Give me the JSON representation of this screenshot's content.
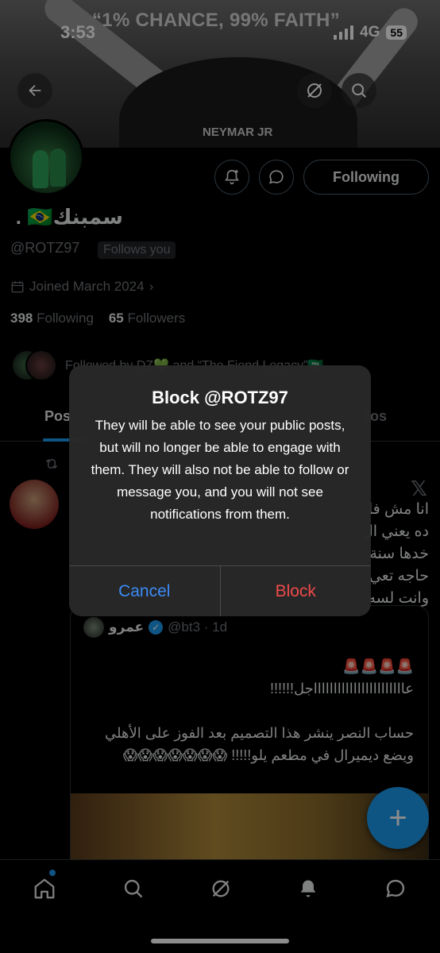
{
  "status_bar": {
    "time": "3:53",
    "network": "4G",
    "battery": "55"
  },
  "banner": {
    "quote": "“1% CHANCE, 99% FAITH”",
    "jersey": "NEYMAR JR"
  },
  "profile": {
    "name": "سمبنك🇧🇷 .",
    "handle": "@ROTZ97",
    "follows_you": "Follows you",
    "joined": "Joined March 2024",
    "following_count": "398",
    "following_label": "Following",
    "followers_count": "65",
    "followers_label": "Followers",
    "followed_by": "Followed by DZ💚 and “The Fiend Legacy”🇸🇦",
    "following_button": "Following"
  },
  "tabs": [
    {
      "label": "Pos"
    },
    {
      "label": "tos"
    }
  ],
  "post": {
    "text": "انا مش فا\nده يعني ال\nخدها سنة\nحاجه تعي\nوانت لسه",
    "quote": {
      "name": "عمرو",
      "meta": "@bt3 · 1d",
      "body": "🚨🚨🚨🚨\nعاااااااااااااااااااااااجل!!!!!!\n\nحساب النصر ينشر هذا التصميم بعد الفوز على الأهلي ويضع ديميرال في مطعم يلو!!!!! 😱😱😱😱😱😱😱"
    }
  },
  "dialog": {
    "title": "Block @ROTZ97",
    "message": "They will be able to see your public posts, but will no longer be able to engage with them. They will also not be able to follow or message you, and you will not see notifications from them.",
    "cancel_label": "Cancel",
    "block_label": "Block"
  },
  "colors": {
    "accent": "#1d9bf0",
    "destructive": "#f04a4a",
    "cancel": "#3b8bf7"
  },
  "icons": [
    "back-arrow-icon",
    "grok-icon",
    "search-icon",
    "notify-plus-icon",
    "message-icon",
    "calendar-icon",
    "retweet-icon",
    "x-logo-icon",
    "verified-icon",
    "home-icon",
    "explore-icon",
    "grok-nav-icon",
    "notifications-icon",
    "messages-icon",
    "compose-plus-icon"
  ]
}
